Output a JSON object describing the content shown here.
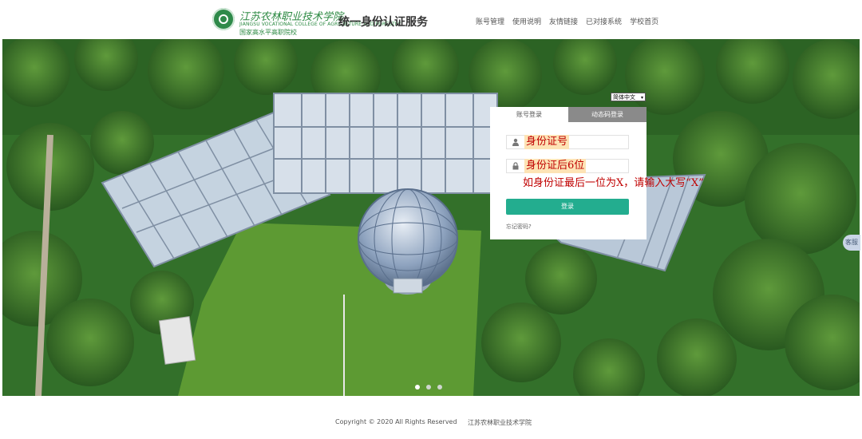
{
  "header": {
    "school_name_cn": "江苏农林职业技术学院",
    "school_name_en": "JIANGSU VOCATIONAL COLLEGE OF AGRICULTURE AND FORESTRY",
    "school_tag": "国家高水平高职院校",
    "service_title": "统一身份认证服务",
    "nav": [
      "账号管理",
      "使用说明",
      "友情链接",
      "已对接系统",
      "学校首页"
    ]
  },
  "login": {
    "language_select": "简体中文",
    "tabs": [
      "账号登录",
      "动态码登录"
    ],
    "username_value": "身份证号",
    "password_value": "身份证后6位",
    "hint": "如身份证最后一位为X，请输入大写“X”",
    "login_button": "登录",
    "forgot_password": "忘记密码?"
  },
  "carousel": {
    "slides": 3,
    "active": 1
  },
  "side_tab": "客服",
  "footer": {
    "copyright": "Copyright © 2020  All Rights Reserved",
    "school": "江苏农林职业技术学院"
  },
  "colors": {
    "accent": "#23ad8f",
    "brand_green": "#2d8a43",
    "hint_red": "#c00000"
  }
}
